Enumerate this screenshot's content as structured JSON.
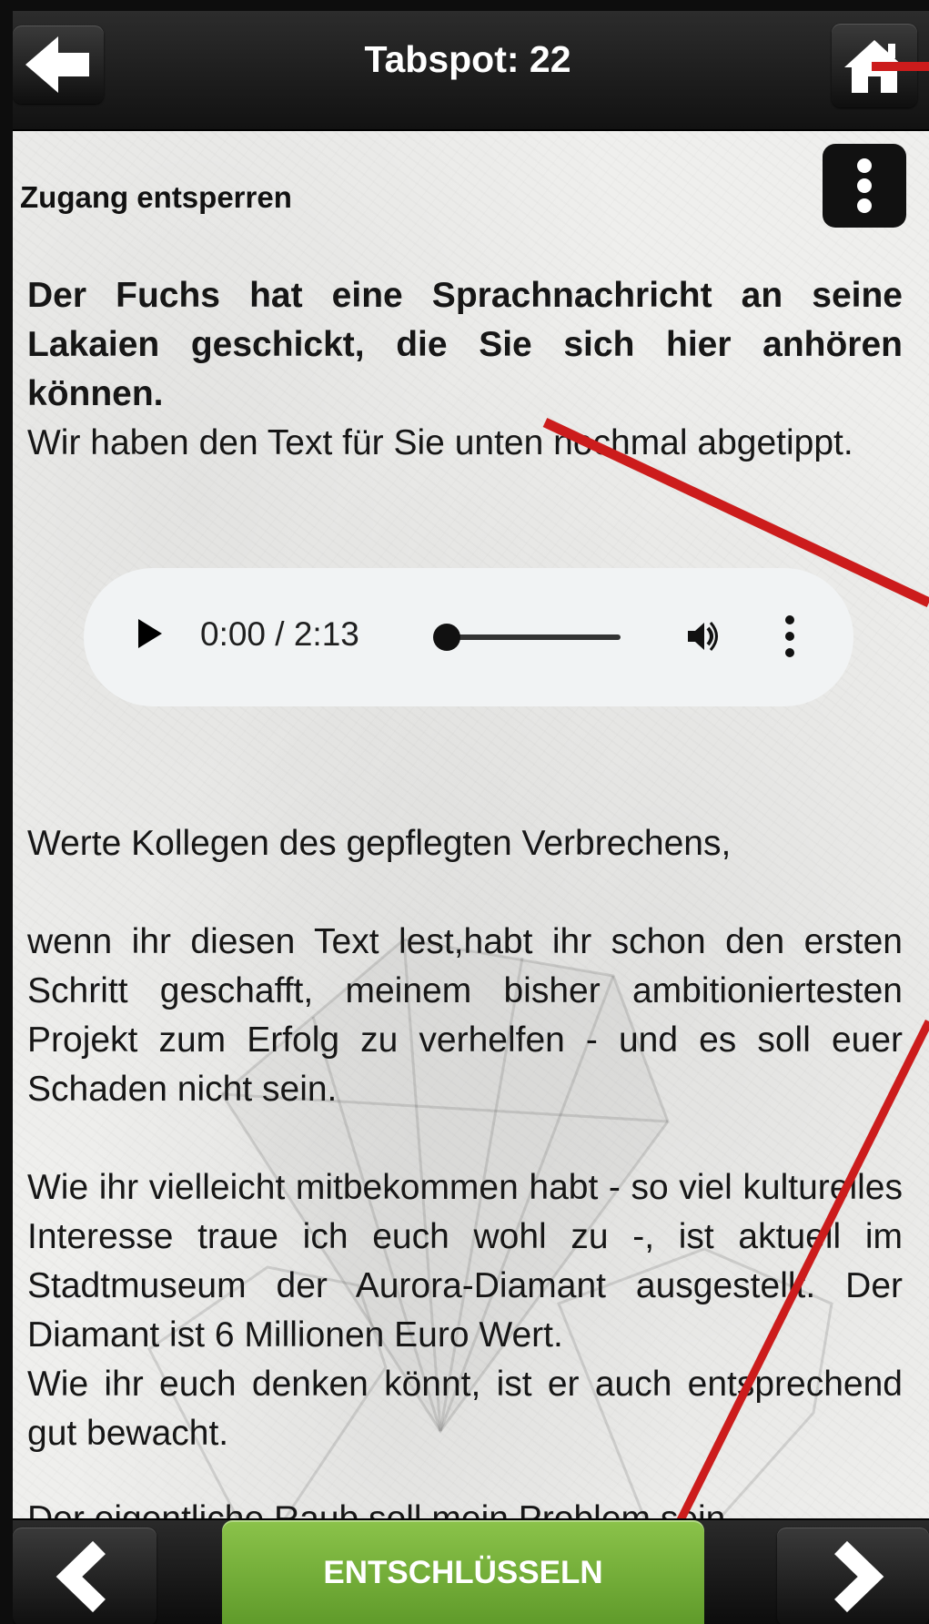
{
  "header": {
    "title": "Tabspot: 22"
  },
  "section": {
    "title": "Zugang entsperren"
  },
  "intro": {
    "bold": "Der Fuchs hat eine Sprachnachricht an seine Lakaien geschickt, die Sie sich hier anhören können.",
    "normal": "Wir haben den Text für Sie unten nochmal abgetippt."
  },
  "audio": {
    "time": "0:00 / 2:13",
    "progress": 0
  },
  "letter": {
    "greeting": "Werte Kollegen des gepflegten Verbrechens,",
    "p1": "wenn ihr diesen Text lest,habt ihr schon den ersten Schritt geschafft, meinem bisher ambitioniertesten Projekt zum Erfolg zu verhelfen - und es soll euer Schaden nicht sein.",
    "p2": "Wie ihr vielleicht mitbekommen habt - so viel kulturelles Interesse traue ich euch wohl zu -, ist aktuell im Stadtmuseum der Aurora-Diamant ausgestellt. Der Diamant ist 6 Millionen Euro Wert.",
    "p3": "Wie ihr euch denken könnt, ist er auch entsprechend gut bewacht.",
    "cut": "Der eigentliche Raub soll mein Problem sein."
  },
  "footer": {
    "decrypt_label": "ENTSCHLÜSSELN"
  },
  "colors": {
    "accent_green": "#7cb342",
    "annotation_red": "#cc1c1c",
    "bar_dark": "#141414"
  },
  "icons": {
    "back": "arrow-left-icon",
    "home": "home-icon",
    "menu": "more-vertical-icon",
    "prev": "chevron-left-icon",
    "next": "chevron-right-icon"
  }
}
